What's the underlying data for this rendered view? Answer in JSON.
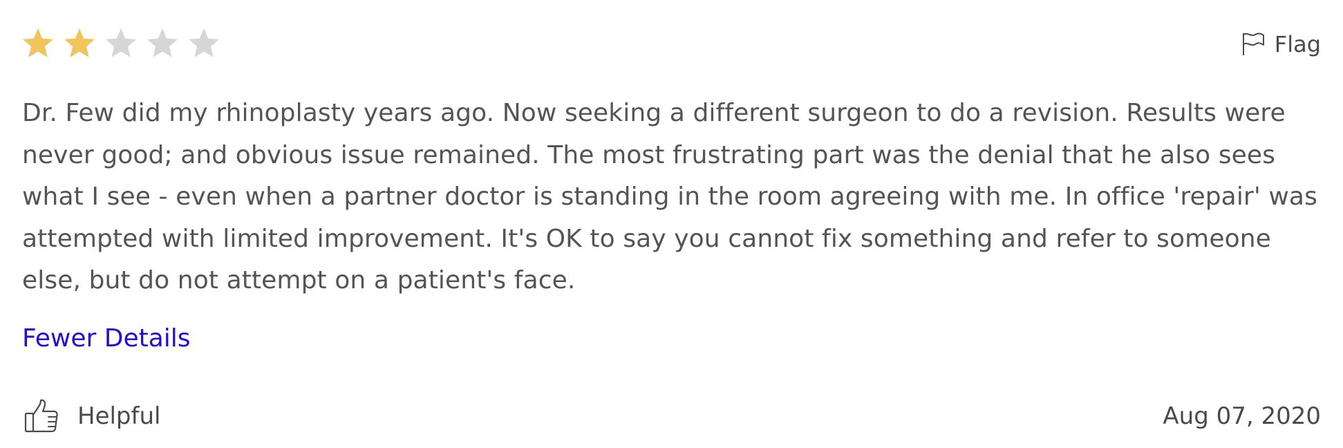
{
  "review": {
    "rating": 2,
    "rating_max": 5,
    "star_filled_color": "#f2c55c",
    "star_empty_color": "#d6d6d6",
    "flag_label": "Flag",
    "flag_icon": "flag-icon",
    "text": "Dr. Few did my rhinoplasty years ago. Now seeking a different surgeon to do a revision. Results were never good; and obvious issue remained. The most frustrating part was the denial that he also sees what I see - even when a partner doctor is standing in the room agreeing with me. In office 'repair' was attempted with limited improvement. It's OK to say you cannot fix something and refer to someone else, but do not attempt on a patient's face.",
    "toggle_label": "Fewer Details",
    "toggle_color": "#1f0fd9",
    "helpful_label": "Helpful",
    "helpful_icon": "thumbs-up-icon",
    "date": "Aug 07, 2020"
  }
}
